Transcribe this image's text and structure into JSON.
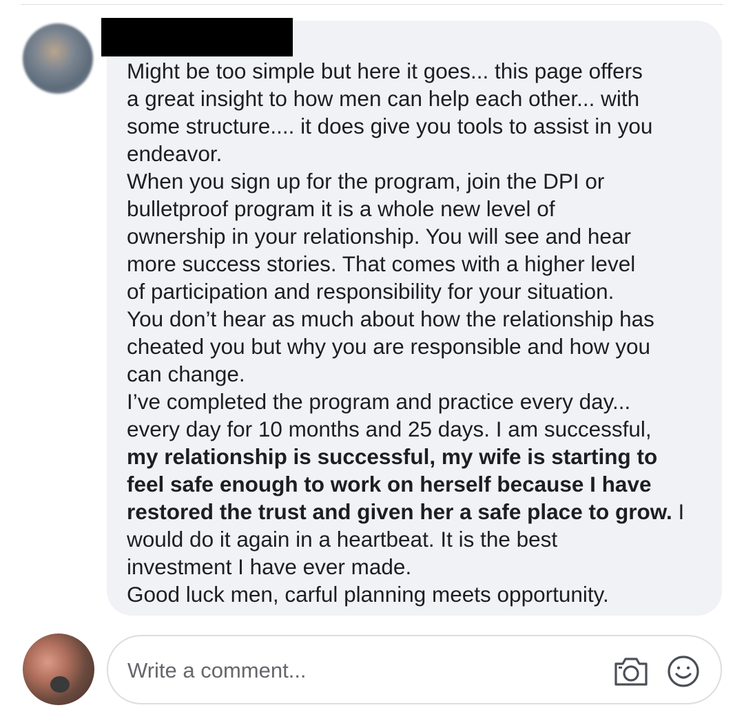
{
  "comment": {
    "author_name": "",
    "lines": [
      {
        "text": "Might be too simple but here it goes... this page offers",
        "bold": false
      },
      {
        "text": "a great insight to how men can help each other... with",
        "bold": false
      },
      {
        "text": "some structure.... it does give you tools to assist in you",
        "bold": false
      },
      {
        "text": "endeavor.",
        "bold": false
      },
      {
        "text": "When you sign up for the program, join the DPI or",
        "bold": false
      },
      {
        "text": "bulletproof program it is a whole new level of",
        "bold": false
      },
      {
        "text": "ownership in your relationship. You will see and hear",
        "bold": false
      },
      {
        "text": "more success stories. That comes with a higher level",
        "bold": false
      },
      {
        "text": "of participation and responsibility for your situation.",
        "bold": false
      },
      {
        "text": "You don’t hear as much about how the relationship has",
        "bold": false
      },
      {
        "text": "cheated you but why you are responsible and how you",
        "bold": false
      },
      {
        "text": "can change.",
        "bold": false
      },
      {
        "text": "I’ve completed the program and practice every day...",
        "bold": false
      },
      {
        "text": "every day for 10 months and 25 days. I am successful,",
        "bold": false
      },
      {
        "text": "my relationship is successful, my wife is starting to",
        "bold": true
      },
      {
        "text": "feel safe enough to work on herself because I have",
        "bold": true
      },
      {
        "text": "restored the trust and given her a safe place to grow.",
        "bold": true,
        "tail": " I"
      },
      {
        "text": "would do it again in a heartbeat. It is the best",
        "bold": false
      },
      {
        "text": "investment I have ever made.",
        "bold": false
      },
      {
        "text": "Good luck men, carful planning meets opportunity.",
        "bold": false
      }
    ]
  },
  "composer": {
    "placeholder": "Write a comment...",
    "value": "",
    "icons": [
      "camera-icon",
      "emoji-icon"
    ]
  },
  "colors": {
    "bubble_bg": "#f0f2f5",
    "text": "#1c1e21",
    "placeholder": "#65676b",
    "icon_stroke": "#4b4f56"
  }
}
